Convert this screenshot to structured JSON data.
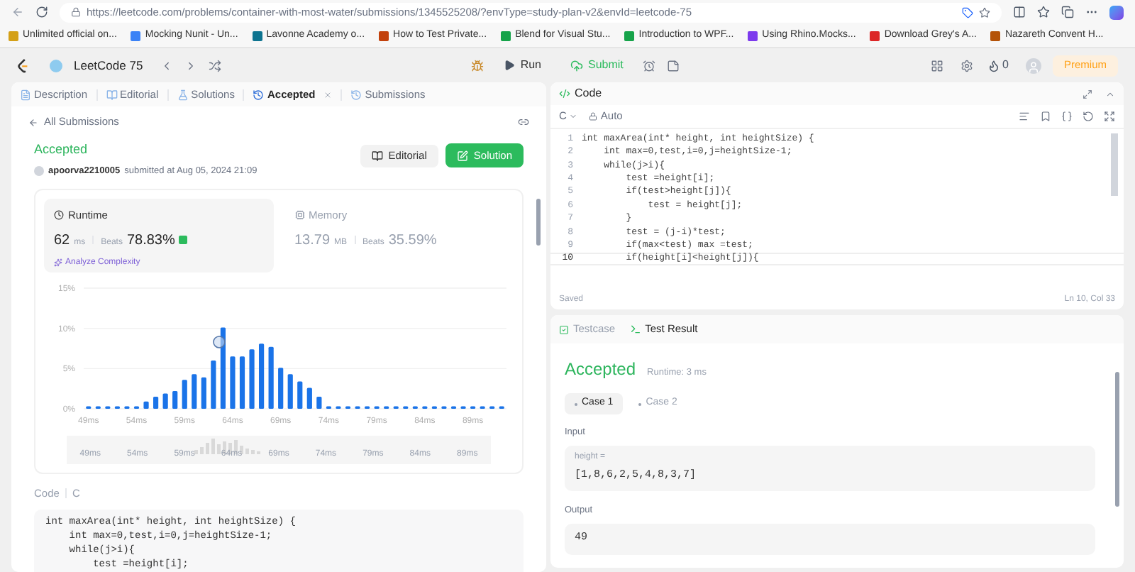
{
  "browser": {
    "url": "https://leetcode.com/problems/container-with-most-water/submissions/1345525208/?envType=study-plan-v2&envId=leetcode-75",
    "bookmarks": [
      {
        "label": "Unlimited official on...",
        "color": "#d4a017"
      },
      {
        "label": "Mocking Nunit - Un...",
        "color": "#3b82f6"
      },
      {
        "label": "Lavonne Academy o...",
        "color": "#0e7490"
      },
      {
        "label": "How to Test Private...",
        "color": "#c2410c"
      },
      {
        "label": "Blend for Visual Stu...",
        "color": "#16a34a"
      },
      {
        "label": "Introduction to WPF...",
        "color": "#16a34a"
      },
      {
        "label": "Using Rhino.Mocks...",
        "color": "#7c3aed"
      },
      {
        "label": "Download Grey's A...",
        "color": "#dc2626"
      },
      {
        "label": "Nazareth Convent H...",
        "color": "#b45309"
      }
    ]
  },
  "toolbar": {
    "title": "LeetCode 75",
    "run": "Run",
    "submit": "Submit",
    "streak": "0",
    "premium": "Premium"
  },
  "left": {
    "tabs": [
      {
        "label": "Description",
        "selected": false,
        "closable": false
      },
      {
        "label": "Editorial",
        "selected": false,
        "closable": false
      },
      {
        "label": "Solutions",
        "selected": false,
        "closable": false
      },
      {
        "label": "Accepted",
        "selected": true,
        "closable": true
      },
      {
        "label": "Submissions",
        "selected": false,
        "closable": false
      }
    ],
    "back": "All Submissions",
    "status": "Accepted",
    "user": "apoorva2210005",
    "submitted": "submitted at Aug 05, 2024 21:09",
    "editorial_button": "Editorial",
    "solution_button": "Solution",
    "stats": [
      {
        "kind": "runtime",
        "label": "Runtime",
        "value": "62",
        "unit": "ms",
        "beats_label": "Beats",
        "beats": "78.83%",
        "selected": true,
        "analyze": "Analyze Complexity"
      },
      {
        "kind": "memory",
        "label": "Memory",
        "value": "13.79",
        "unit": "MB",
        "beats_label": "Beats",
        "beats": "35.59%",
        "selected": false
      }
    ],
    "chart_data": {
      "type": "bar",
      "x": [
        49,
        50,
        51,
        52,
        53,
        54,
        55,
        56,
        57,
        58,
        59,
        60,
        61,
        62,
        63,
        64,
        65,
        66,
        67,
        68,
        69,
        70,
        71,
        72,
        73,
        74,
        75,
        76,
        77,
        78,
        79,
        80,
        81,
        82,
        83,
        84,
        85,
        86,
        87,
        88,
        89,
        90,
        91,
        92
      ],
      "xlim": [
        48.5,
        92.5
      ],
      "series": [
        {
          "color": "#1a73e8",
          "values": [
            0.3,
            0.3,
            0.3,
            0.3,
            0.3,
            0.3,
            0.9,
            1.5,
            1.9,
            2.2,
            3.6,
            4.3,
            3.9,
            6.0,
            10.1,
            6.5,
            6.5,
            7.4,
            8.1,
            7.7,
            5.1,
            4.3,
            3.4,
            2.6,
            1.5,
            0.3,
            0.3,
            0.3,
            0.3,
            0.3,
            0.3,
            0.3,
            0.3,
            0.3,
            0.3,
            0.3,
            0.3,
            0.3,
            0.3,
            0.3,
            0.3,
            0.3,
            0.3,
            0.3
          ]
        }
      ],
      "ylim": [
        0,
        15
      ],
      "yticks": [
        {
          "value": 0,
          "label": "0%"
        },
        {
          "value": 5,
          "label": "5%"
        },
        {
          "value": 10,
          "label": "10%"
        },
        {
          "value": 15,
          "label": "15%"
        }
      ],
      "xticks": [
        {
          "value": 49,
          "label": "49ms"
        },
        {
          "value": 54,
          "label": "54ms"
        },
        {
          "value": 59,
          "label": "59ms"
        },
        {
          "value": 64,
          "label": "64ms"
        },
        {
          "value": 69,
          "label": "69ms"
        },
        {
          "value": 74,
          "label": "74ms"
        },
        {
          "value": 79,
          "label": "79ms"
        },
        {
          "value": 84,
          "label": "84ms"
        },
        {
          "value": 89,
          "label": "89ms"
        }
      ]
    },
    "overview_labels": [
      "49ms",
      "54ms",
      "59ms",
      "64ms",
      "69ms",
      "74ms",
      "79ms",
      "84ms",
      "89ms"
    ],
    "code_label": "Code",
    "language": "C",
    "code": [
      "int maxArea(int* height, int heightSize) {",
      "    int max=0,test,i=0,j=heightSize-1;",
      "    while(j>i){",
      "        test =height[i];"
    ]
  },
  "editor": {
    "title": "Code",
    "language": "C",
    "mode": "Auto",
    "lines": [
      {
        "n": "1",
        "text": "int maxArea(int* height, int heightSize) {",
        "current": false
      },
      {
        "n": "2",
        "text": "    int max=0,test,i=0,j=heightSize-1;",
        "current": false
      },
      {
        "n": "3",
        "text": "    while(j>i){",
        "current": false
      },
      {
        "n": "4",
        "text": "        test =height[i];",
        "current": false
      },
      {
        "n": "5",
        "text": "        if(test>height[j]){",
        "current": false
      },
      {
        "n": "6",
        "text": "            test = height[j];",
        "current": false
      },
      {
        "n": "7",
        "text": "        }",
        "current": false
      },
      {
        "n": "8",
        "text": "        test = (j-i)*test;",
        "current": false
      },
      {
        "n": "9",
        "text": "        if(max<test) max =test;",
        "current": false
      },
      {
        "n": "10",
        "text": "        if(height[i]<height[j]){",
        "current": true
      }
    ],
    "saved": "Saved",
    "position": "Ln 10, Col 33"
  },
  "tests": {
    "tabs": [
      {
        "label": "Testcase",
        "selected": false
      },
      {
        "label": "Test Result",
        "selected": true
      }
    ],
    "status": "Accepted",
    "runtime": "Runtime: 3 ms",
    "cases": [
      {
        "label": "Case 1",
        "selected": true
      },
      {
        "label": "Case 2",
        "selected": false
      }
    ],
    "input_label": "Input",
    "param": "height =",
    "input": "[1,8,6,2,5,4,8,3,7]",
    "output_label": "Output",
    "output": "49"
  }
}
